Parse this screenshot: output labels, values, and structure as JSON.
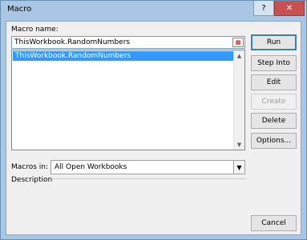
{
  "window": {
    "title": "Macro",
    "help_label": "?",
    "close_label": "✕"
  },
  "macro_name": {
    "label": "Macro name:",
    "value": "ThisWorkbook.RandomNumbers"
  },
  "macro_list": {
    "items": [
      "ThisWorkbook.RandomNumbers"
    ],
    "selected_index": 0
  },
  "macros_in": {
    "label": "Macros in:",
    "value": "All Open Workbooks"
  },
  "description": {
    "label": "Description"
  },
  "buttons": {
    "run": "Run",
    "step_into": "Step Into",
    "edit": "Edit",
    "create": "Create",
    "delete": "Delete",
    "options": "Options...",
    "cancel": "Cancel"
  }
}
